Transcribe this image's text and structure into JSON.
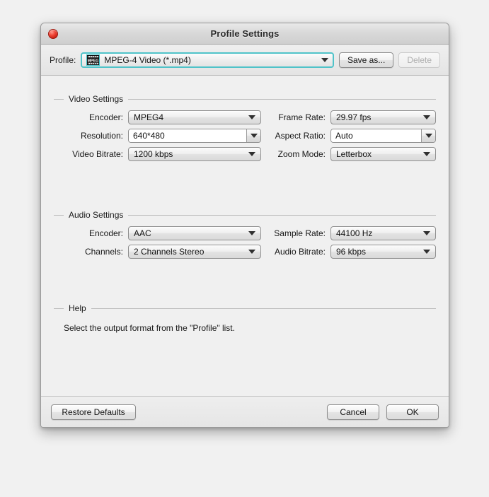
{
  "window": {
    "title": "Profile Settings",
    "close_icon": "close-button-red"
  },
  "profile_bar": {
    "label": "Profile:",
    "icon": "mpeg-film-icon",
    "value": "MPEG-4 Video (*.mp4)",
    "dropdown_icon": "chevron-down-icon",
    "save_as_label": "Save as...",
    "delete_label": "Delete"
  },
  "video_settings": {
    "title": "Video Settings",
    "encoder_label": "Encoder:",
    "encoder_value": "MPEG4",
    "resolution_label": "Resolution:",
    "resolution_value": "640*480",
    "video_bitrate_label": "Video Bitrate:",
    "video_bitrate_value": "1200 kbps",
    "frame_rate_label": "Frame Rate:",
    "frame_rate_value": "29.97 fps",
    "aspect_ratio_label": "Aspect Ratio:",
    "aspect_ratio_value": "Auto",
    "zoom_mode_label": "Zoom Mode:",
    "zoom_mode_value": "Letterbox"
  },
  "audio_settings": {
    "title": "Audio Settings",
    "encoder_label": "Encoder:",
    "encoder_value": "AAC",
    "channels_label": "Channels:",
    "channels_value": "2 Channels Stereo",
    "sample_rate_label": "Sample Rate:",
    "sample_rate_value": "44100 Hz",
    "audio_bitrate_label": "Audio Bitrate:",
    "audio_bitrate_value": "96 kbps"
  },
  "help": {
    "title": "Help",
    "text": "Select the output format from the \"Profile\" list."
  },
  "footer": {
    "restore_defaults_label": "Restore Defaults",
    "cancel_label": "Cancel",
    "ok_label": "OK"
  },
  "colors": {
    "focus_ring": "#4fc3c9",
    "close_button": "#ef4334",
    "window_bg": "#f0f0f0",
    "separator": "#bdbdbd"
  }
}
